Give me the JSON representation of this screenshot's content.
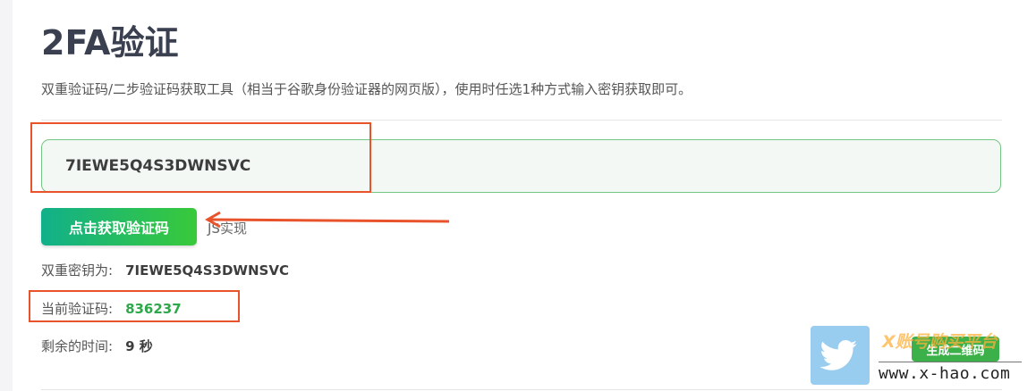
{
  "page": {
    "title": "2FA验证",
    "subtitle": "双重验证码/二步验证码获取工具（相当于谷歌身份验证器的网页版），使用时任选1种方式输入密钥获取即可。"
  },
  "form": {
    "secret_value": "7IEWE5Q4S3DWNSVC",
    "get_button_label": "点击获取验证码",
    "js_note": "JS实现"
  },
  "results": {
    "secret_label": "双重密钥为:",
    "secret_value": "7IEWE5Q4S3DWNSVC",
    "code_label": "当前验证码:",
    "code_value": "836237",
    "time_label": "剩余的时间:",
    "time_value": "9 秒"
  },
  "overlay": {
    "qr_button_label": "生成二维码",
    "watermark_title": "X账号购买平台",
    "watermark_url": "www.x-hao.com",
    "twitter_icon": "twitter-bird-icon"
  },
  "colors": {
    "accent_red": "#e8532b",
    "input_border": "#74c684",
    "code_green": "#2ea84a",
    "button_gradient_start": "#11b08a",
    "button_gradient_end": "#39c93a"
  }
}
